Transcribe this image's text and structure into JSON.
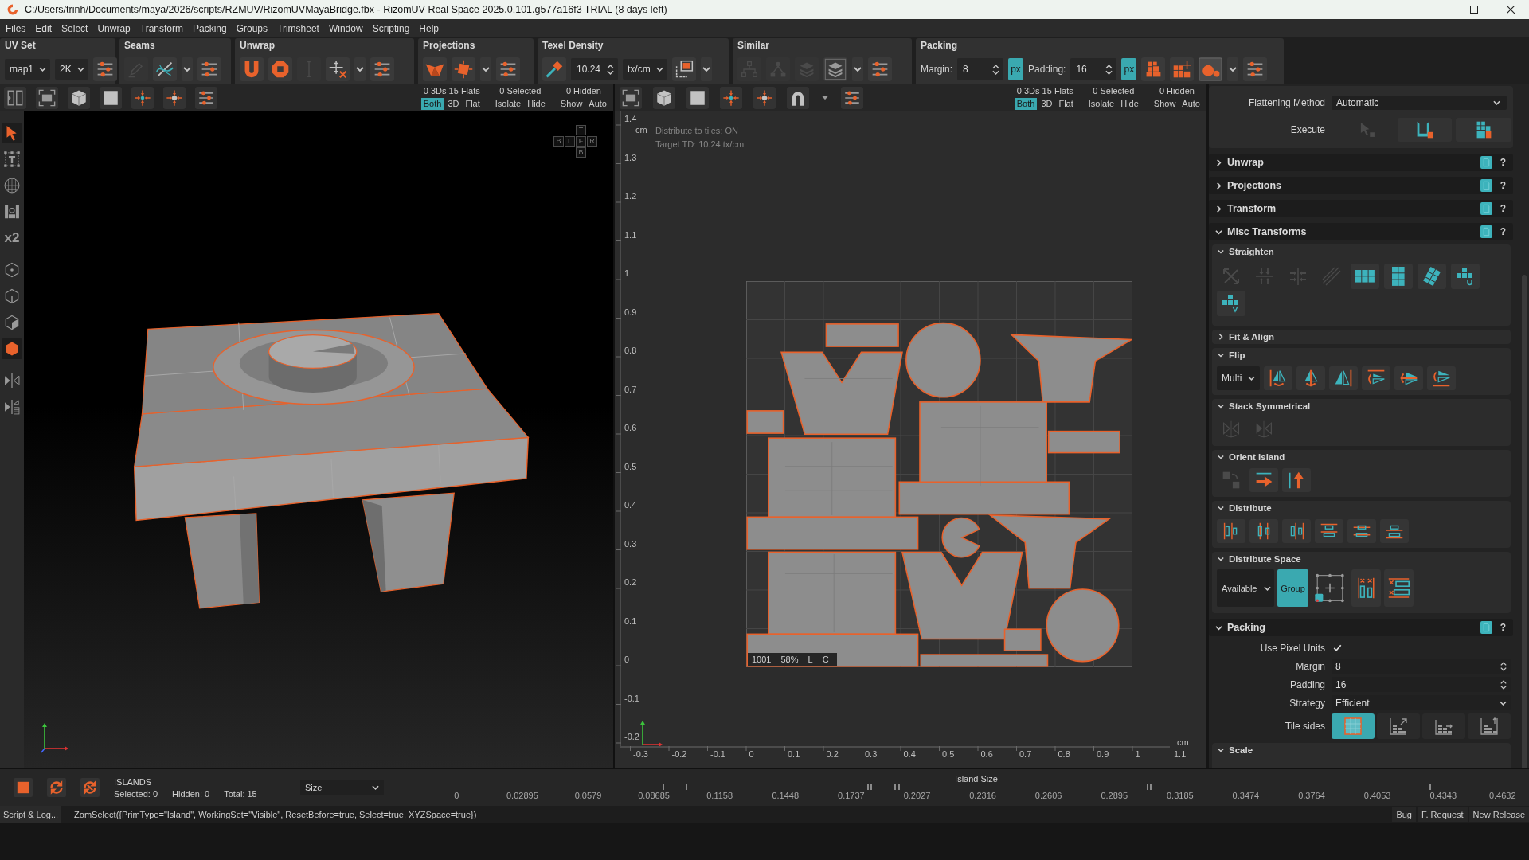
{
  "window": {
    "title": "C:/Users/trinh/Documents/maya/2026/scripts/RZMUV/RizomUVMayaBridge.fbx - RizomUV  Real Space 2025.0.101.g577a16f3 TRIAL (8 days left)"
  },
  "menu": [
    "Files",
    "Edit",
    "Select",
    "Unwrap",
    "Transform",
    "Packing",
    "Groups",
    "Trimsheet",
    "Window",
    "Scripting",
    "Help"
  ],
  "toolbar": [
    {
      "title": "UV Set",
      "items": [
        {
          "kind": "dropdown",
          "value": "map1"
        },
        {
          "kind": "dropdown",
          "value": "2K"
        },
        {
          "kind": "tool",
          "disabled": false
        }
      ]
    },
    {
      "title": "Seams",
      "items": [
        {
          "kind": "tool",
          "disabled": true
        },
        {
          "kind": "tool",
          "disabled": false
        },
        {
          "kind": "caret"
        },
        {
          "kind": "tool",
          "disabled": false
        }
      ]
    },
    {
      "title": "Unwrap",
      "items": [
        {
          "kind": "tool",
          "disabled": false
        },
        {
          "kind": "tool",
          "disabled": false
        },
        {
          "kind": "tool",
          "disabled": true
        },
        {
          "kind": "tool",
          "disabled": false
        },
        {
          "kind": "caret"
        },
        {
          "kind": "tool",
          "disabled": false
        }
      ]
    },
    {
      "title": "Projections",
      "items": [
        {
          "kind": "tool",
          "disabled": false
        },
        {
          "kind": "tool",
          "disabled": false
        },
        {
          "kind": "caret"
        },
        {
          "kind": "tool",
          "disabled": false
        }
      ]
    },
    {
      "title": "Texel Density",
      "items": [
        {
          "kind": "tool",
          "disabled": false
        },
        {
          "kind": "spinbox",
          "value": "10.24"
        },
        {
          "kind": "dropdown",
          "value": "tx/cm"
        },
        {
          "kind": "tool",
          "disabled": false
        },
        {
          "kind": "caret"
        }
      ]
    },
    {
      "title": "Similar",
      "items": [
        {
          "kind": "tool",
          "disabled": true
        },
        {
          "kind": "tool",
          "disabled": true
        },
        {
          "kind": "tool",
          "disabled": true
        },
        {
          "kind": "tool",
          "disabled": false
        },
        {
          "kind": "caret"
        },
        {
          "kind": "tool",
          "disabled": false
        }
      ]
    },
    {
      "title": "Packing",
      "items": [
        {
          "kind": "label",
          "text": "Margin:"
        },
        {
          "kind": "spinbox",
          "value": "8"
        },
        {
          "kind": "toggle",
          "text": "px",
          "selected": true
        },
        {
          "kind": "label",
          "text": "Padding:"
        },
        {
          "kind": "spinbox",
          "value": "16"
        },
        {
          "kind": "toggle",
          "text": "px",
          "selected": true
        },
        {
          "kind": "tool",
          "disabled": false
        },
        {
          "kind": "tool",
          "disabled": false
        },
        {
          "kind": "tool",
          "disabled": false
        },
        {
          "kind": "caret"
        },
        {
          "kind": "tool",
          "disabled": false
        }
      ]
    }
  ],
  "viewports": [
    {
      "kind": "perspective",
      "display": [
        {
          "stat": "0 3Ds 15 Flats",
          "buttons": [
            {
              "label": "Both",
              "selected": true
            },
            {
              "label": "3D",
              "selected": false
            },
            {
              "label": "Flat",
              "selected": false
            }
          ]
        },
        {
          "stat": "0 Selected",
          "buttons": [
            {
              "label": "Isolate"
            },
            {
              "label": "Hide"
            }
          ]
        },
        {
          "stat": "0 Hidden",
          "buttons": [
            {
              "label": "Show"
            },
            {
              "label": "Auto"
            }
          ]
        }
      ],
      "view_cube": [
        "T",
        "B",
        "L",
        "F",
        "R",
        "B"
      ]
    },
    {
      "kind": "uv",
      "display": [
        {
          "stat": "0 3Ds 15 Flats",
          "buttons": [
            {
              "label": "Both",
              "selected": true
            },
            {
              "label": "3D",
              "selected": false
            },
            {
              "label": "Flat",
              "selected": false
            }
          ]
        },
        {
          "stat": "0 Selected",
          "buttons": [
            {
              "label": "Isolate"
            },
            {
              "label": "Hide"
            }
          ]
        },
        {
          "stat": "0 Hidden",
          "buttons": [
            {
              "label": "Show"
            },
            {
              "label": "Auto"
            }
          ]
        }
      ],
      "info": [
        "Distribute to tiles: ON",
        "Target TD: 10.24 tx/cm"
      ],
      "v_ruler": [
        "1.4",
        "1.3",
        "1.2",
        "1.1",
        "1",
        "0.9",
        "0.8",
        "0.7",
        "0.6",
        "0.5",
        "0.4",
        "0.3",
        "0.2",
        "0.1",
        "0",
        "-0.1",
        "-0.2"
      ],
      "v_unit": "cm",
      "h_ruler": [
        "-0.3",
        "-0.2",
        "-0.1",
        "0",
        "0.1",
        "0.2",
        "0.3",
        "0.4",
        "0.5",
        "0.6",
        "0.7",
        "0.8",
        "0.9",
        "1",
        "1.1"
      ],
      "h_unit": "cm",
      "tile_info": [
        "1001",
        "58%",
        "L",
        "C"
      ]
    }
  ],
  "left_tools": [
    [
      {
        "kind": "tool",
        "selected": true
      },
      {
        "kind": "tool",
        "selected": false
      },
      {
        "kind": "tool",
        "selected": false
      },
      {
        "kind": "tool",
        "selected": false
      },
      {
        "kind": "text",
        "label": "x2",
        "selected": false
      }
    ],
    [
      {
        "kind": "tool",
        "selected": false
      },
      {
        "kind": "tool",
        "selected": false
      },
      {
        "kind": "tool",
        "selected": false
      },
      {
        "kind": "tool",
        "selected": true
      }
    ],
    [
      {
        "kind": "tool",
        "selected": false
      },
      {
        "kind": "tool",
        "selected": false
      }
    ]
  ],
  "panel": {
    "flattening": {
      "label": "Flattening Method",
      "value": "Automatic"
    },
    "execute": {
      "label": "Execute",
      "tools": [
        {
          "disabled": true
        },
        {
          "disabled": false
        },
        {
          "disabled": false
        }
      ]
    },
    "sections": [
      {
        "title": "Unwrap",
        "help": "?",
        "expanded": false
      },
      {
        "title": "Projections",
        "help": "?",
        "expanded": false
      },
      {
        "title": "Transform",
        "help": "?",
        "expanded": false
      },
      {
        "title": "Misc Transforms",
        "help": "?",
        "expanded": true,
        "subsections": [
          {
            "title": "Straighten",
            "expanded": true,
            "tools": [
              {
                "disabled": true
              },
              {
                "disabled": true
              },
              {
                "disabled": true
              },
              {
                "disabled": true
              },
              {
                "disabled": false
              },
              {
                "disabled": false
              },
              {
                "disabled": false
              },
              {
                "disabled": false
              },
              {
                "disabled": false
              }
            ]
          },
          {
            "title": "Fit & Align",
            "expanded": false
          },
          {
            "title": "Flip",
            "expanded": true,
            "dropdown": "Multi",
            "tools": [
              {
                "disabled": false
              },
              {
                "disabled": false
              },
              {
                "disabled": false
              },
              {
                "disabled": false
              },
              {
                "disabled": false
              },
              {
                "disabled": false
              }
            ]
          },
          {
            "title": "Stack Symmetrical",
            "expanded": true,
            "tools": [
              {
                "disabled": true
              },
              {
                "disabled": true
              }
            ]
          },
          {
            "title": "Orient Island",
            "expanded": true,
            "tools": [
              {
                "disabled": true
              },
              {
                "disabled": false
              },
              {
                "disabled": false
              }
            ]
          },
          {
            "title": "Distribute",
            "expanded": true,
            "tools": [
              {
                "disabled": false
              },
              {
                "disabled": false
              },
              {
                "disabled": false
              },
              {
                "disabled": false
              },
              {
                "disabled": false
              },
              {
                "disabled": false
              }
            ]
          },
          {
            "title": "Distribute Space",
            "expanded": true,
            "dropdown": "Available",
            "toggle": {
              "label": "Group",
              "selected": true
            },
            "tools": [
              {
                "disabled": false
              },
              {
                "disabled": false
              },
              {
                "disabled": false
              }
            ]
          }
        ]
      },
      {
        "title": "Packing",
        "help": "?",
        "expanded": true,
        "fields": [
          {
            "kind": "checkbox",
            "label": "Use Pixel Units",
            "checked": true
          },
          {
            "kind": "spinbox",
            "label": "Margin",
            "value": "8"
          },
          {
            "kind": "spinbox",
            "label": "Padding",
            "value": "16"
          },
          {
            "kind": "dropdown",
            "label": "Strategy",
            "value": "Efficient"
          },
          {
            "kind": "tiles",
            "label": "Tile sides",
            "options": [
              {
                "selected": true
              },
              {
                "selected": false
              },
              {
                "selected": false
              },
              {
                "selected": false
              }
            ]
          }
        ],
        "subsections": [
          {
            "title": "Scale",
            "expanded": true
          }
        ]
      }
    ]
  },
  "islands": {
    "title": "ISLANDS",
    "counts": [
      "Selected: 0",
      "Hidden: 0",
      "Total: 15"
    ],
    "metric": "Size",
    "chart_title": "Island Size",
    "axis": [
      "0",
      "0.02895",
      "0.0579",
      "0.08685",
      "0.1158",
      "0.1448",
      "0.1737",
      "0.2027",
      "0.2316",
      "0.2606",
      "0.2895",
      "0.3185",
      "0.3474",
      "0.3764",
      "0.4053",
      "0.4343",
      "0.4632"
    ]
  },
  "status_bar": {
    "log_button": "Script & Log...",
    "command": "ZomSelect({PrimType=\"Island\", WorkingSet=\"Visible\", ResetBefore=true, Select=true, XYZSpace=true})",
    "links": [
      "Bug",
      "F. Request",
      "New Release"
    ]
  }
}
